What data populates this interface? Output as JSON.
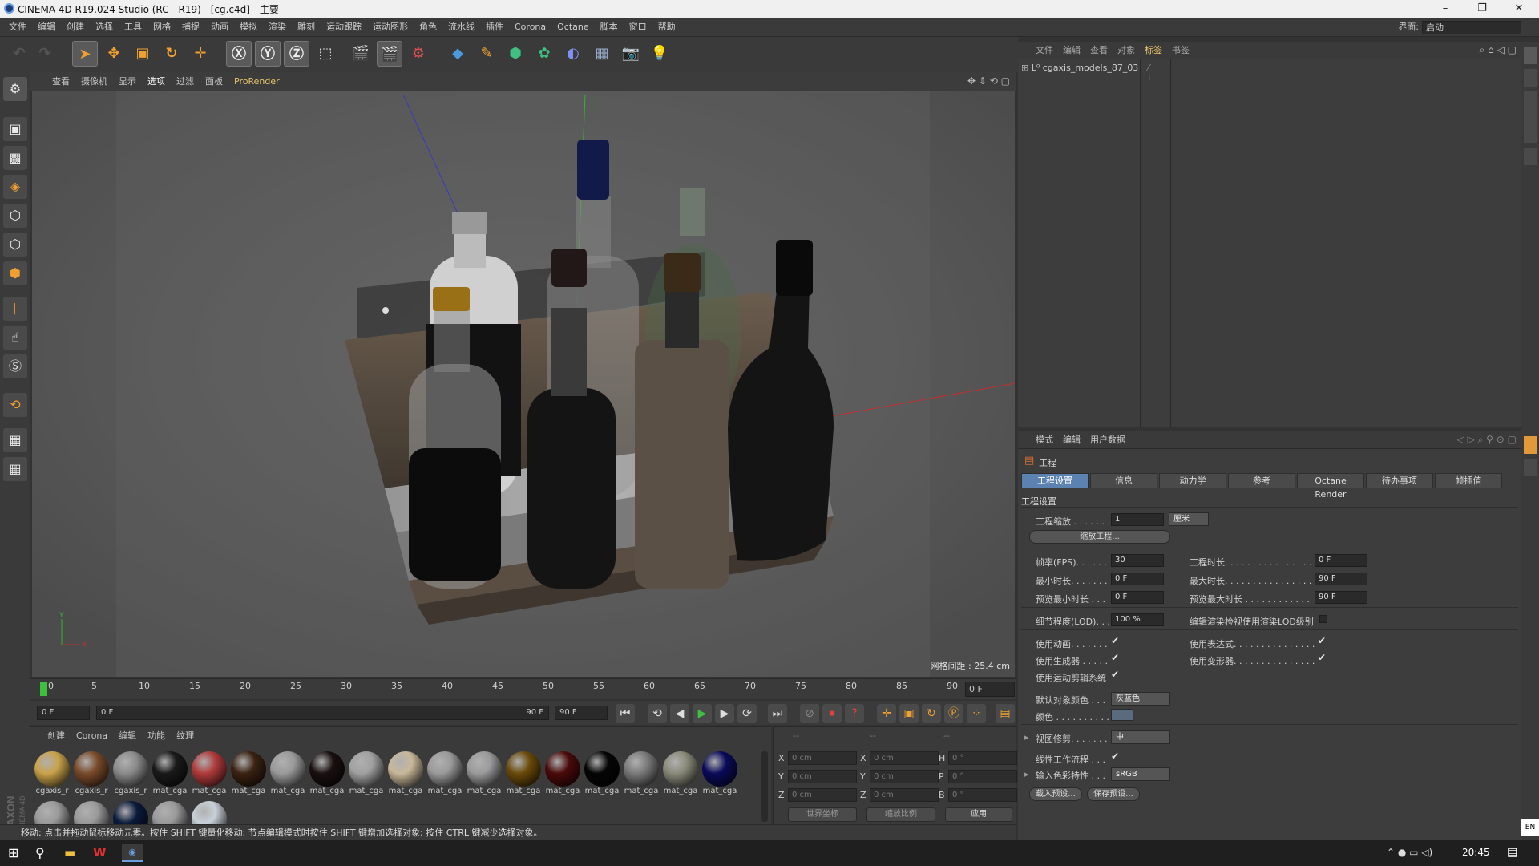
{
  "window": {
    "title": "CINEMA 4D R19.024 Studio (RC - R19) - [cg.c4d] - 主要",
    "minimize": "–",
    "maximize": "❐",
    "close": "✕"
  },
  "menubar": [
    "文件",
    "编辑",
    "创建",
    "选择",
    "工具",
    "网格",
    "捕捉",
    "动画",
    "模拟",
    "渲染",
    "雕刻",
    "运动跟踪",
    "运动图形",
    "角色",
    "流水线",
    "插件",
    "Corona",
    "Octane",
    "脚本",
    "窗口",
    "帮助"
  ],
  "interface": {
    "label": "界面:",
    "value": "启动"
  },
  "viewport": {
    "menu": [
      "查看",
      "摄像机",
      "显示",
      "选项",
      "过滤",
      "面板",
      "ProRender"
    ],
    "grid_info": "网格间距 : 25.4 cm",
    "axis_labels": {
      "x": "X",
      "y": "Y"
    }
  },
  "timeline": {
    "ticks": [
      "0",
      "5",
      "10",
      "15",
      "20",
      "25",
      "30",
      "35",
      "40",
      "45",
      "50",
      "55",
      "60",
      "65",
      "70",
      "75",
      "80",
      "85",
      "90"
    ],
    "end_field": "0 F"
  },
  "transport": {
    "current": "0 F",
    "range_start": "0 F",
    "range_end": "90 F",
    "max": "90 F"
  },
  "materials": {
    "menu": [
      "创建",
      "Corona",
      "编辑",
      "功能",
      "纹理"
    ],
    "items": [
      {
        "label": "cgaxis_r",
        "color": "#c9a24a"
      },
      {
        "label": "cgaxis_r",
        "color": "#7a4a2a"
      },
      {
        "label": "cgaxis_r",
        "color": "#8a8a8a"
      },
      {
        "label": "mat_cga",
        "color": "#1a1a1a"
      },
      {
        "label": "mat_cga",
        "color": "#b03a3a"
      },
      {
        "label": "mat_cga",
        "color": "#3a2212"
      },
      {
        "label": "mat_cga",
        "color": "#9a9a9a"
      },
      {
        "label": "mat_cga",
        "color": "#1a1010"
      },
      {
        "label": "mat_cga",
        "color": "#a0a0a0"
      },
      {
        "label": "mat_cga",
        "color": "#c8b89a"
      },
      {
        "label": "mat_cga",
        "color": "#9a9a9a"
      },
      {
        "label": "mat_cga",
        "color": "#9a9a9a"
      },
      {
        "label": "mat_cga",
        "color": "#6a4a0a"
      },
      {
        "label": "mat_cga",
        "color": "#4a0a0a"
      },
      {
        "label": "mat_cga",
        "color": "#050505"
      },
      {
        "label": "mat_cga",
        "color": "#7a7a7a"
      },
      {
        "label": "mat_cga",
        "color": "#8a8a7a"
      },
      {
        "label": "mat_cga",
        "color": "#0a0a5a"
      }
    ],
    "row2": [
      {
        "color": "#9a9a9a"
      },
      {
        "color": "#9a9a9a"
      },
      {
        "color": "#0a1a3a"
      },
      {
        "color": "#9a9a9a"
      },
      {
        "color": "#c8d0d8"
      }
    ]
  },
  "coords": {
    "rows": [
      {
        "a": "X",
        "av": "0 cm",
        "b": "X",
        "bv": "0 cm",
        "c": "H",
        "cv": "0 °"
      },
      {
        "a": "Y",
        "av": "0 cm",
        "b": "Y",
        "bv": "0 cm",
        "c": "P",
        "cv": "0 °"
      },
      {
        "a": "Z",
        "av": "0 cm",
        "b": "Z",
        "bv": "0 cm",
        "c": "B",
        "cv": "0 °"
      }
    ],
    "world": "世界坐标",
    "scale": "缩放比例",
    "apply": "应用",
    "dashes": "--"
  },
  "status": "移动: 点击并拖动鼠标移动元素。按住 SHIFT 键量化移动; 节点编辑模式时按住 SHIFT 键增加选择对象; 按住 CTRL 键减少选择对象。",
  "objects": {
    "menu": [
      "文件",
      "编辑",
      "查看",
      "对象",
      "标签",
      "书签"
    ],
    "active_menu": "标签",
    "root": "cgaxis_models_87_03"
  },
  "attributes": {
    "menu": [
      "模式",
      "编辑",
      "用户数据"
    ],
    "title": "工程",
    "tabs": [
      "工程设置",
      "信息",
      "动力学",
      "参考",
      "Octane Render",
      "待办事项",
      "帧插值"
    ],
    "section": "工程设置",
    "scale_label": "工程缩放 . . . . . .",
    "scale_value": "1",
    "scale_unit": "厘米",
    "scale_btn": "缩放工程...",
    "fps_label": "帧率(FPS). . . . . .",
    "fps": "30",
    "proj_len_label": "工程时长. . . . . . . . . . . . . . . .",
    "proj_len": "0 F",
    "min_label": "最小时长. . . . . . .",
    "min": "0 F",
    "max_label": "最大时长. . . . . . . . . . . . . . . .",
    "max": "90 F",
    "pmin_label": "预览最小时长 . . .",
    "pmin": "0 F",
    "pmax_label": "预览最大时长 . . . . . . . . . . . .",
    "pmax": "90 F",
    "lod_label": "细节程度(LOD). . .",
    "lod": "100 %",
    "lod_check_label": "编辑渲染检视使用渲染LOD级别",
    "anim_label": "使用动画. . . . . . .",
    "expr_label": "使用表达式. . . . . . . . . . . . . . .",
    "gen_label": "使用生成器 . . . . .",
    "deform_label": "使用变形器. . . . . . . . . . . . . . .",
    "mograph_label": "使用运动剪辑系统",
    "defcolor_label": "默认对象颜色 . . .",
    "defcolor": "灰蓝色",
    "color_label": "颜色 . . . . . . . . . .",
    "clip_label": "视图修剪. . . . . . .",
    "clip": "中",
    "linear_label": "线性工作流程 . . .",
    "inprofile_label": "输入色彩特性 . . .",
    "inprofile": "sRGB",
    "load_btn": "载入预设...",
    "save_btn": "保存预设..."
  },
  "taskbar": {
    "lang": "EN",
    "time": "20:45"
  }
}
